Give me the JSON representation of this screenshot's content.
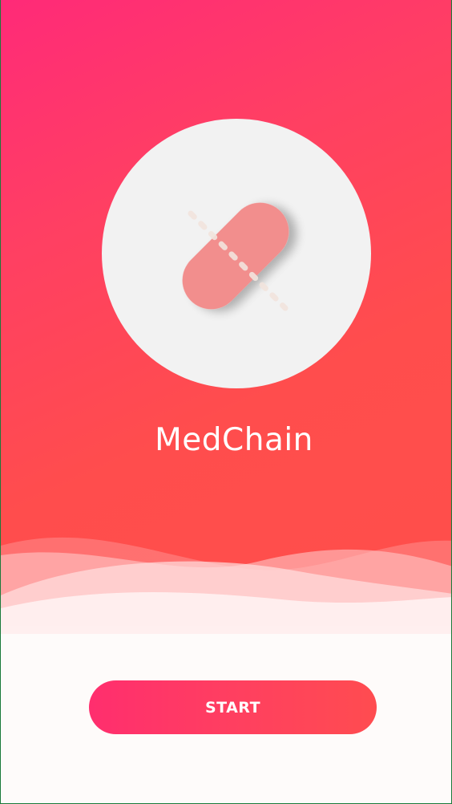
{
  "app": {
    "title": "MedChain",
    "logo_icon": "pill-icon"
  },
  "actions": {
    "start_label": "START"
  },
  "colors": {
    "gradient_start": "#ff2a78",
    "gradient_end": "#ff4d4d",
    "logo_background": "#f2f2f2",
    "pill": "#f28c8c",
    "text": "#ffffff"
  }
}
